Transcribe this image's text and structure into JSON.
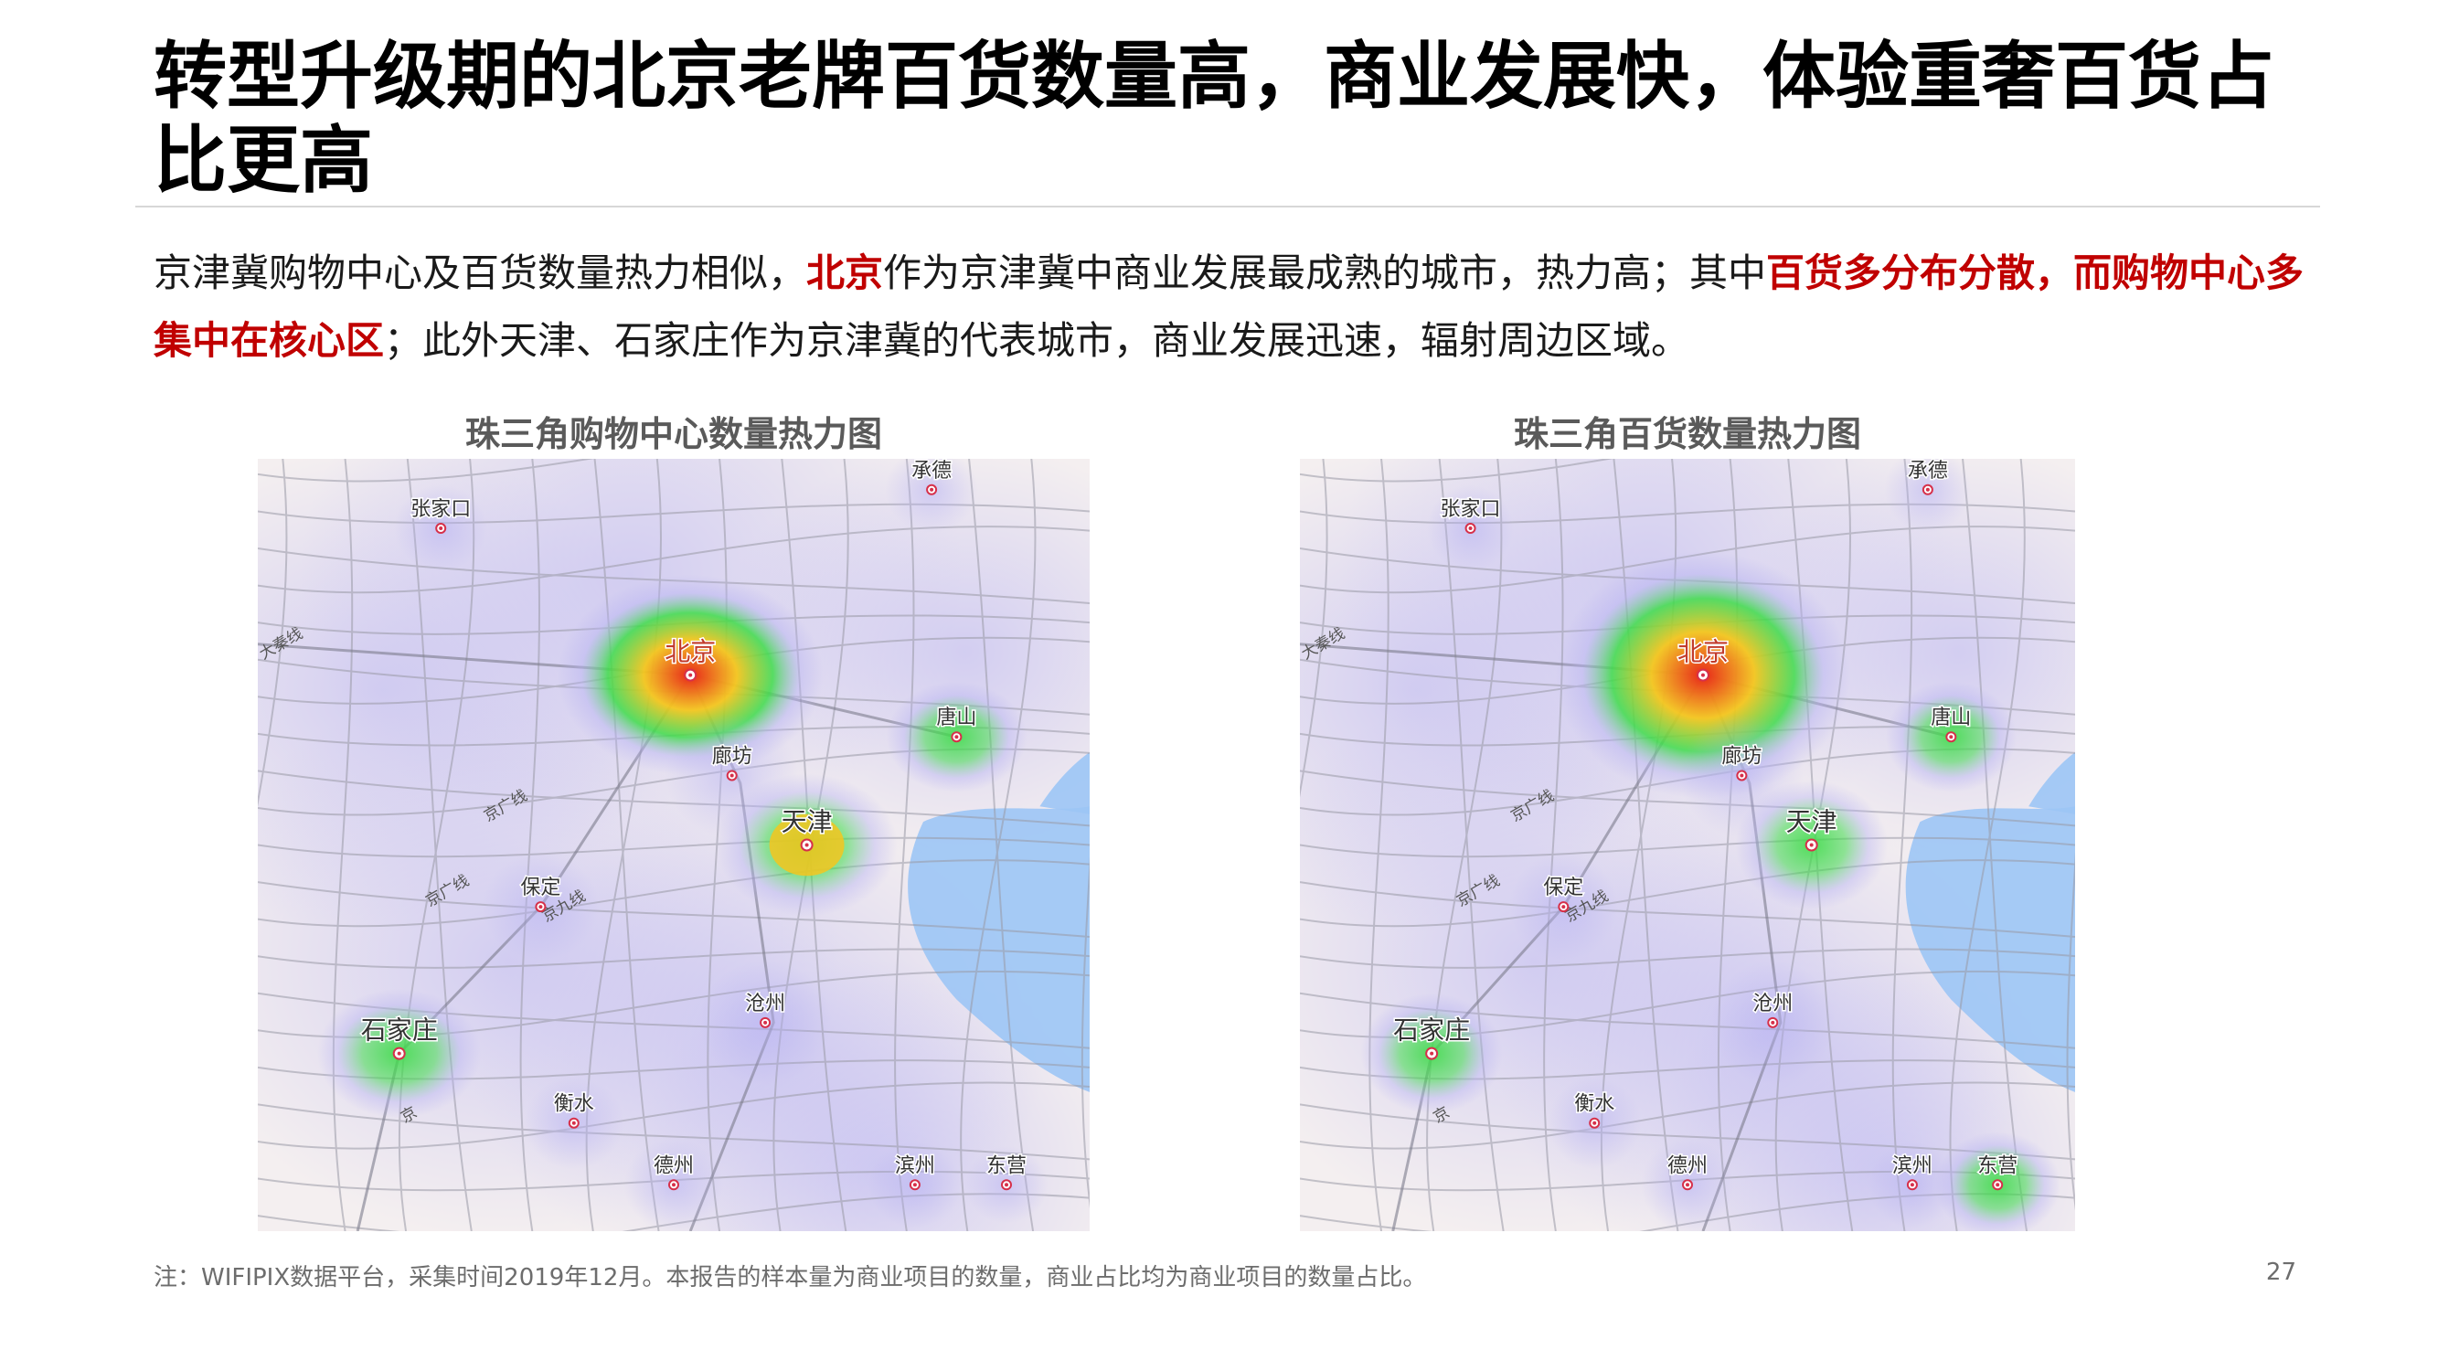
{
  "slide": {
    "title": "转型升级期的北京老牌百货数量高，商业发展快，体验重奢百货占比更高",
    "intro_parts": [
      {
        "text": "京津冀购物中心及百货数量热力相似，",
        "highlight": false
      },
      {
        "text": "北京",
        "highlight": true
      },
      {
        "text": "作为京津冀中商业发展最成熟的城市，热力高；其中",
        "highlight": false
      },
      {
        "text": "百货多分布分散，而购物中心多集中在核心区",
        "highlight": true
      },
      {
        "text": "；此外天津、石家庄作为京津冀的代表城市，商业发展迅速，辐射周边区域。",
        "highlight": false
      }
    ],
    "footnote": "注：WIFIPIX数据平台，采集时间2019年12月。本报告的样本量为商业项目的数量，商业占比均为商业项目的数量占比。",
    "page_number": "27"
  },
  "colors": {
    "highlight": "#c00000",
    "sea": "#9cc5f5",
    "hot": "#e8261a",
    "warm": "#f4c61e",
    "mild": "#3fdc4a",
    "cool": "#b7b2f2"
  },
  "maps": [
    {
      "title": "珠三角购物中心数量热力图",
      "road_labels": [
        "大秦线",
        "京广线",
        "京九线",
        "京广线",
        "京"
      ],
      "cities": [
        {
          "name": "张家口",
          "intensity": 0.08
        },
        {
          "name": "承德",
          "intensity": 0.08
        },
        {
          "name": "北京",
          "intensity": 1.0
        },
        {
          "name": "唐山",
          "intensity": 0.35
        },
        {
          "name": "廊坊",
          "intensity": 0.2
        },
        {
          "name": "天津",
          "intensity": 0.7
        },
        {
          "name": "保定",
          "intensity": 0.15
        },
        {
          "name": "沧州",
          "intensity": 0.2
        },
        {
          "name": "石家庄",
          "intensity": 0.55
        },
        {
          "name": "衡水",
          "intensity": 0.1
        },
        {
          "name": "德州",
          "intensity": 0.1
        },
        {
          "name": "滨州",
          "intensity": 0.08
        },
        {
          "name": "东营",
          "intensity": 0.05
        }
      ]
    },
    {
      "title": "珠三角百货数量热力图",
      "road_labels": [
        "大秦线",
        "京广线",
        "京九线",
        "京广线",
        "京"
      ],
      "cities": [
        {
          "name": "张家口",
          "intensity": 0.08
        },
        {
          "name": "承德",
          "intensity": 0.08
        },
        {
          "name": "北京",
          "intensity": 1.0
        },
        {
          "name": "唐山",
          "intensity": 0.35
        },
        {
          "name": "廊坊",
          "intensity": 0.2
        },
        {
          "name": "天津",
          "intensity": 0.55
        },
        {
          "name": "保定",
          "intensity": 0.15
        },
        {
          "name": "沧州",
          "intensity": 0.2
        },
        {
          "name": "石家庄",
          "intensity": 0.45
        },
        {
          "name": "衡水",
          "intensity": 0.1
        },
        {
          "name": "德州",
          "intensity": 0.1
        },
        {
          "name": "滨州",
          "intensity": 0.08
        },
        {
          "name": "东营",
          "intensity": 0.3
        }
      ]
    }
  ]
}
